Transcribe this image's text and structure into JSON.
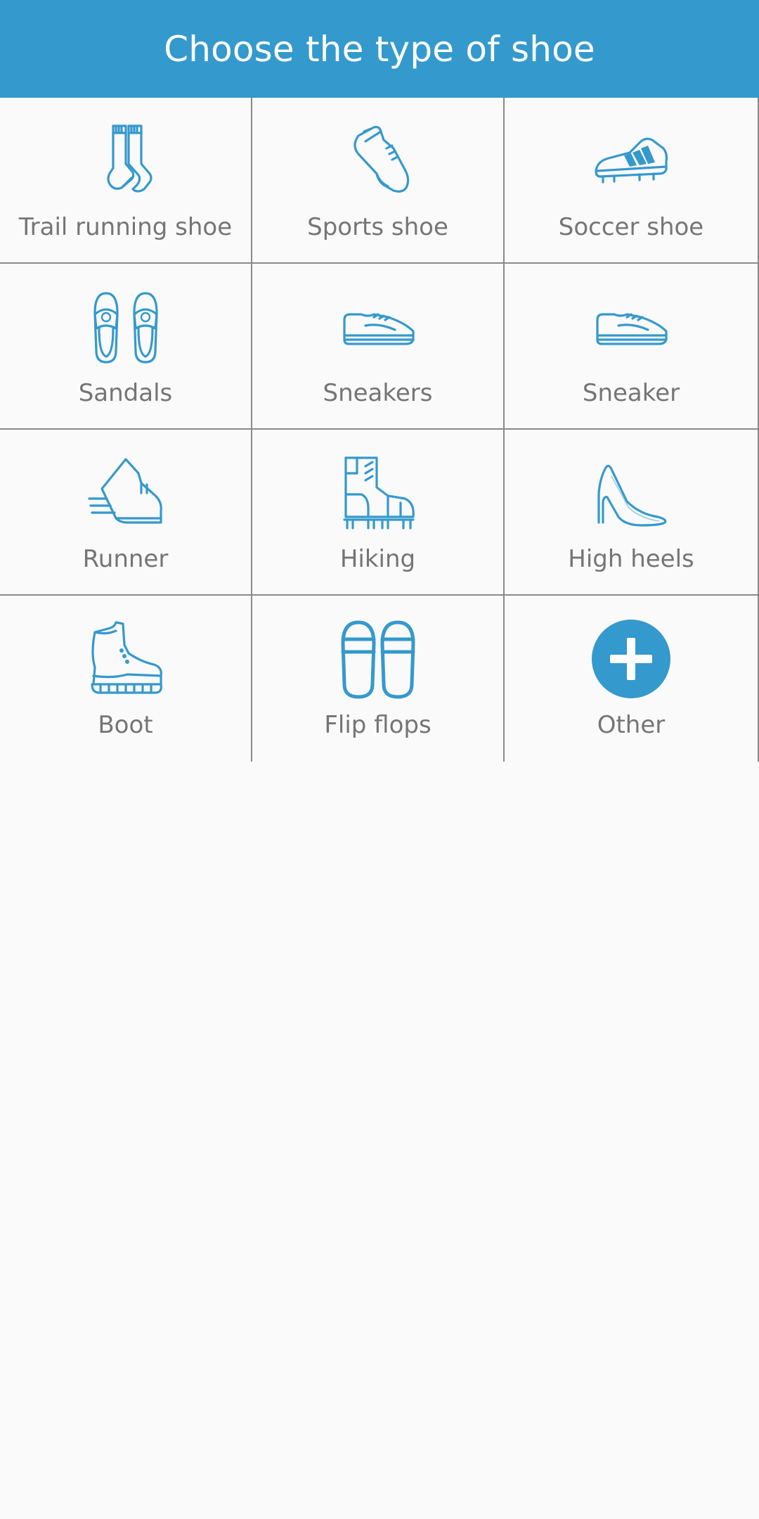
{
  "header": {
    "title": "Choose the type of shoe"
  },
  "colors": {
    "accent": "#3499cd",
    "label": "#757575",
    "grid_line": "#8a8a8a",
    "background": "#fafafa"
  },
  "shoe_types": [
    {
      "label": "Trail running shoe",
      "icon": "socks-icon"
    },
    {
      "label": "Sports shoe",
      "icon": "sports-shoe-icon"
    },
    {
      "label": "Soccer shoe",
      "icon": "soccer-cleat-icon"
    },
    {
      "label": "Sandals",
      "icon": "sandals-icon"
    },
    {
      "label": "Sneakers",
      "icon": "sneakers-icon"
    },
    {
      "label": "Sneaker",
      "icon": "sneaker-icon"
    },
    {
      "label": "Runner",
      "icon": "running-shoe-icon"
    },
    {
      "label": "Hiking",
      "icon": "hiking-boot-icon"
    },
    {
      "label": "High heels",
      "icon": "high-heel-icon"
    },
    {
      "label": "Boot",
      "icon": "boot-icon"
    },
    {
      "label": "Flip flops",
      "icon": "flip-flops-icon"
    },
    {
      "label": "Other",
      "icon": "plus-circle-icon"
    }
  ]
}
